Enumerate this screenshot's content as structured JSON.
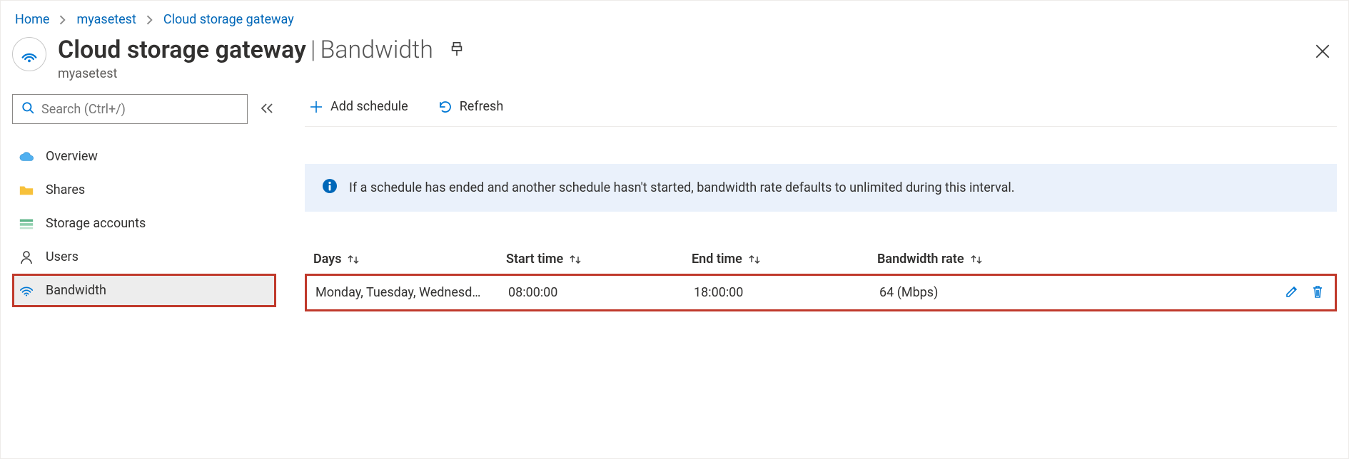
{
  "breadcrumbs": {
    "items": [
      {
        "label": "Home"
      },
      {
        "label": "myasetest"
      },
      {
        "label": "Cloud storage gateway"
      }
    ]
  },
  "header": {
    "title_main": "Cloud storage gateway",
    "title_section": "Bandwidth",
    "subtitle": "myasetest"
  },
  "search": {
    "placeholder": "Search (Ctrl+/)"
  },
  "sidebar": {
    "items": [
      {
        "label": "Overview",
        "icon": "cloud",
        "active": false
      },
      {
        "label": "Shares",
        "icon": "folder",
        "active": false
      },
      {
        "label": "Storage accounts",
        "icon": "storage",
        "active": false
      },
      {
        "label": "Users",
        "icon": "user",
        "active": false
      },
      {
        "label": "Bandwidth",
        "icon": "wifi",
        "active": true,
        "highlight": true
      }
    ]
  },
  "toolbar": {
    "add_label": "Add schedule",
    "refresh_label": "Refresh"
  },
  "info": {
    "message": "If a schedule has ended and another schedule hasn't started, bandwidth rate defaults to unlimited during this interval."
  },
  "table": {
    "columns": {
      "days": "Days",
      "start": "Start time",
      "end": "End time",
      "rate": "Bandwidth rate"
    },
    "rows": [
      {
        "days": "Monday, Tuesday, Wednesd…",
        "start": "08:00:00",
        "end": "18:00:00",
        "rate": "64 (Mbps)",
        "highlight": true
      }
    ]
  }
}
